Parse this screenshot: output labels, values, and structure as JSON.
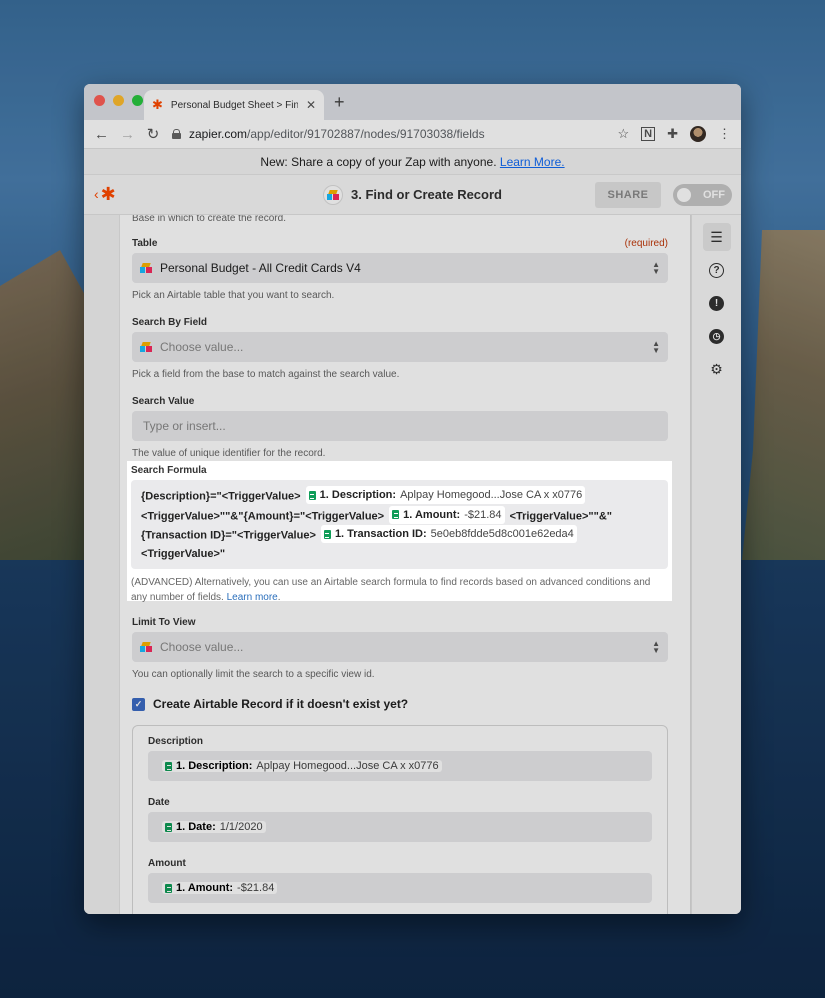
{
  "browser": {
    "tab_title": "Personal Budget Sheet > Find o",
    "url_host": "zapier.com",
    "url_path": "/app/editor/91702887/nodes/91703038/fields"
  },
  "banner": {
    "text": "New: Share a copy of your Zap with anyone.",
    "link": "Learn More."
  },
  "header": {
    "step_title": "3. Find or Create Record",
    "share_label": "SHARE",
    "toggle_label": "OFF"
  },
  "form": {
    "base_hint": "Base in which to create the record.",
    "table": {
      "label": "Table",
      "required": "(required)",
      "value": "Personal Budget - All Credit Cards V4",
      "hint": "Pick an Airtable table that you want to search."
    },
    "search_by_field": {
      "label": "Search By Field",
      "placeholder": "Choose value...",
      "hint": "Pick a field from the base to match against the search value."
    },
    "search_value": {
      "label": "Search Value",
      "placeholder": "Type or insert...",
      "hint": "The value of unique identifier for the record."
    },
    "search_formula": {
      "label": "Search Formula",
      "t1": "{Description}=\"<TriggerValue>",
      "p1_key": "1. Description:",
      "p1_val": "Aplpay Homegood...Jose CA x x0776",
      "t2": "<TriggerValue>\"\"&\"{Amount}=\"<TriggerValue>",
      "p2_key": "1. Amount:",
      "p2_val": "-$21.84",
      "t3": "<TriggerValue>\"\"&\"",
      "t4": "{Transaction ID}=\"<TriggerValue>",
      "p3_key": "1. Transaction ID:",
      "p3_val": "5e0eb8fdde5d8c001e62eda4",
      "t5": "<TriggerValue>\"",
      "hint": "(ADVANCED) Alternatively, you can use an Airtable search formula to find records based on advanced conditions and any number of fields.",
      "hint_link": "Learn more"
    },
    "limit_to_view": {
      "label": "Limit To View",
      "placeholder": "Choose value...",
      "hint": "You can optionally limit the search to a specific view id."
    },
    "create_record": {
      "label": "Create Airtable Record if it doesn't exist yet?",
      "description_label": "Description",
      "description_key": "1. Description:",
      "description_val": "Aplpay Homegood...Jose CA x x0776",
      "date_label": "Date",
      "date_key": "1. Date:",
      "date_val": "1/1/2020",
      "amount_label": "Amount",
      "amount_key": "1. Amount:",
      "amount_val": "-$21.84"
    }
  },
  "colors": {
    "zapier_orange": "#ff4a00",
    "link_blue": "#136bf5",
    "required_red": "#c1390b",
    "sheets_green": "#0f9d58",
    "checkbox_blue": "#3c6cc5"
  },
  "icons": [
    "back-arrow-icon",
    "forward-arrow-icon",
    "reload-icon",
    "lock-icon",
    "star-icon",
    "extensions-icon",
    "menu-icon",
    "zapier-logo-icon",
    "airtable-icon",
    "google-sheets-icon",
    "details-icon",
    "help-icon",
    "alert-icon",
    "history-icon",
    "settings-icon"
  ]
}
